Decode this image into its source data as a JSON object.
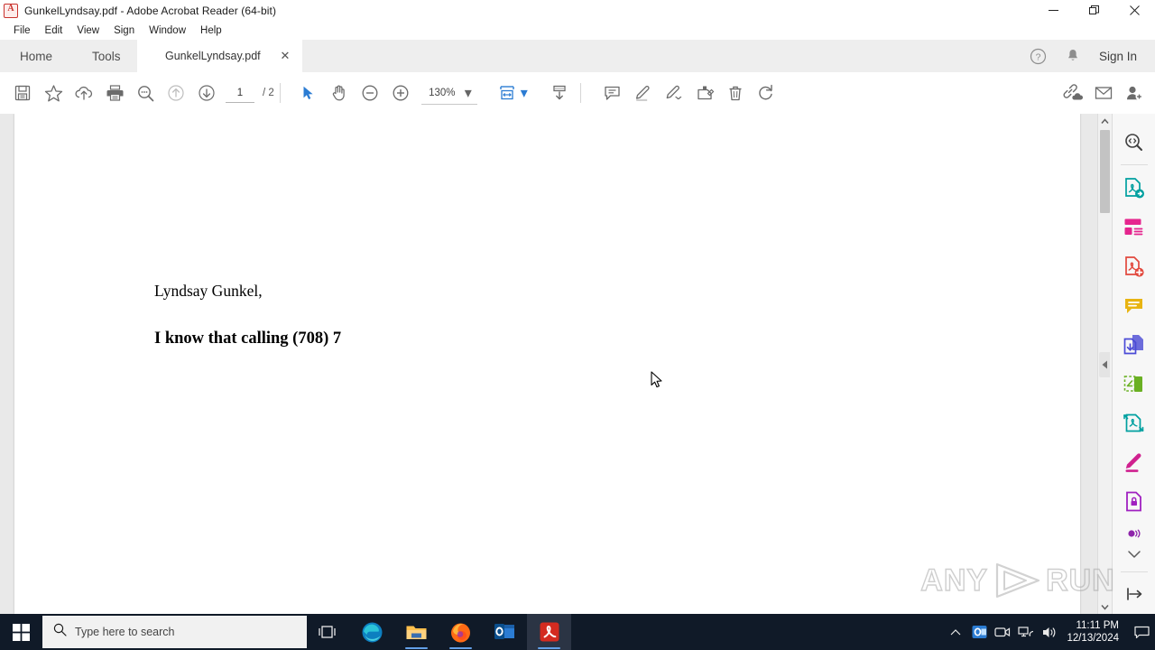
{
  "window": {
    "title": "GunkelLyndsay.pdf - Adobe Acrobat Reader (64-bit)",
    "app_icon": "acrobat-icon",
    "controls": {
      "minimize": "minimize-icon",
      "restore": "restore-icon",
      "close": "close-icon"
    }
  },
  "menu": {
    "items": [
      "File",
      "Edit",
      "View",
      "Sign",
      "Window",
      "Help"
    ]
  },
  "tabbar": {
    "home_label": "Home",
    "tools_label": "Tools",
    "document_tab": "GunkelLyndsay.pdf",
    "close_glyph": "✕",
    "help_icon": "help-circle-icon",
    "bell_icon": "notification-bell-icon",
    "signin_label": "Sign In"
  },
  "toolbar": {
    "left_icons": [
      {
        "name": "save-file-icon",
        "title": "Save file"
      },
      {
        "name": "add-to-favorites-icon",
        "title": "Add to favorites"
      },
      {
        "name": "upload-to-cloud-icon",
        "title": "Save to cloud"
      },
      {
        "name": "print-file-icon",
        "title": "Print file"
      },
      {
        "name": "find-text-icon",
        "title": "Find text"
      },
      {
        "name": "previous-page-icon",
        "title": "Previous page"
      },
      {
        "name": "next-page-icon",
        "title": "Next page"
      }
    ],
    "page_value": "1",
    "page_total": "/ 2",
    "select_tool_icon": "select-cursor-icon",
    "hand_tool_icon": "hand-pan-icon",
    "zoom_out_icon": "zoom-out-icon",
    "zoom_in_icon": "zoom-in-icon",
    "zoom_value": "130%",
    "zoom_caret": "▾",
    "fit_page_icon": "fit-page-icon",
    "fit_caret": "▾",
    "scroll_mode_icon": "scroll-mode-icon",
    "right_icons": [
      {
        "name": "add-comment-icon",
        "title": "Add comment"
      },
      {
        "name": "highlight-text-icon",
        "title": "Highlight text"
      },
      {
        "name": "draw-freehand-icon",
        "title": "Draw free form"
      },
      {
        "name": "add-stamp-icon",
        "title": "Add stamp"
      },
      {
        "name": "delete-icon",
        "title": "Delete"
      },
      {
        "name": "rotate-icon",
        "title": "Rotate"
      }
    ],
    "far_right_icons": [
      {
        "name": "share-link-icon",
        "title": "Share a link"
      },
      {
        "name": "send-email-icon",
        "title": "Send by email"
      },
      {
        "name": "invite-people-icon",
        "title": "Invite people"
      }
    ]
  },
  "document": {
    "line1": "Lyndsay Gunkel,",
    "line2": "I know that calling (708) 7"
  },
  "navigation": {
    "expand_panel_icon": "expand-left-panel-icon",
    "collapse_panel_icon": "collapse-right-panel-icon",
    "scroll_up_icon": "scroll-up-icon",
    "scroll_down_icon": "scroll-down-icon"
  },
  "right_rail": {
    "items": [
      {
        "name": "search-tool-icon",
        "label": "Search",
        "color": "#3f3f3f"
      },
      {
        "name": "export-pdf-icon",
        "label": "Export PDF",
        "color": "#00a0a0"
      },
      {
        "name": "create-pdf-icon",
        "label": "Create PDF",
        "color": "#e5258e"
      },
      {
        "name": "edit-pdf-icon",
        "label": "Edit PDF",
        "color": "#e2483d"
      },
      {
        "name": "comment-tool-icon",
        "label": "Comment",
        "color": "#e8b412"
      },
      {
        "name": "combine-files-icon",
        "label": "Combine Files",
        "color": "#4a4ad6"
      },
      {
        "name": "organize-pages-icon",
        "label": "Organize Pages",
        "color": "#6ab023"
      },
      {
        "name": "compress-pdf-icon",
        "label": "Compress PDF",
        "color": "#00a0a0"
      },
      {
        "name": "fill-and-sign-icon",
        "label": "Fill & Sign",
        "color": "#d0218f"
      },
      {
        "name": "protect-pdf-icon",
        "label": "Protect",
        "color": "#a020c0"
      },
      {
        "name": "more-tools-icon",
        "label": "More Tools",
        "color": "#8e24aa"
      }
    ],
    "chevron_glyph": "⌄"
  },
  "watermark": {
    "text_left": "ANY",
    "text_right": "RUN"
  },
  "taskbar": {
    "start_icon": "windows-start-icon",
    "search_placeholder": "Type here to search",
    "search_icon": "search-icon",
    "task_view_icon": "task-view-icon",
    "apps": [
      {
        "name": "taskbar-edge-icon",
        "label": "Microsoft Edge"
      },
      {
        "name": "taskbar-file-explorer-icon",
        "label": "File Explorer"
      },
      {
        "name": "taskbar-firefox-icon",
        "label": "Mozilla Firefox"
      },
      {
        "name": "taskbar-outlook-icon",
        "label": "Outlook"
      },
      {
        "name": "taskbar-acrobat-icon",
        "label": "Adobe Acrobat Reader"
      }
    ],
    "tray": {
      "chevron": "∧",
      "icons": [
        "tray-outlook-icon",
        "tray-camera-icon",
        "tray-network-icon",
        "tray-volume-icon"
      ],
      "time": "11:11 PM",
      "date": "12/13/2024",
      "action_center_icon": "action-center-icon"
    }
  }
}
